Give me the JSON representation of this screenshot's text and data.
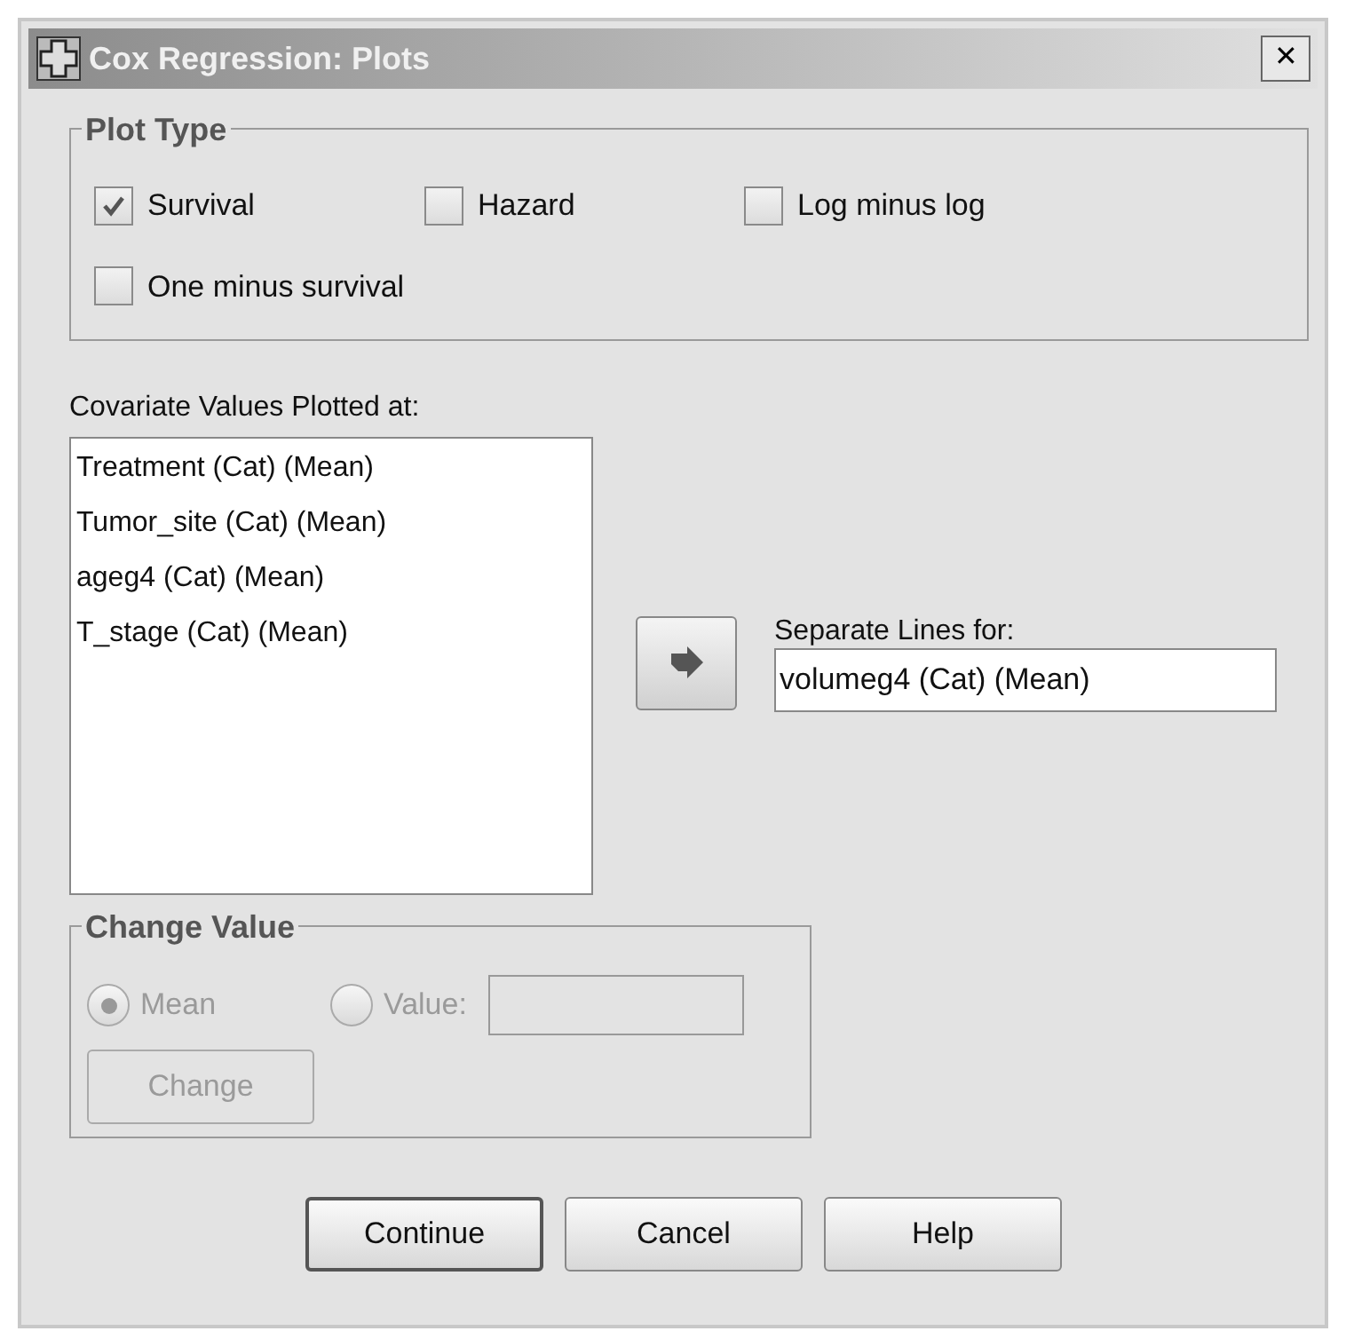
{
  "window": {
    "title": "Cox Regression: Plots",
    "close": "✕"
  },
  "plot_type": {
    "legend": "Plot Type",
    "options": [
      {
        "label": "Survival",
        "checked": true
      },
      {
        "label": "Hazard",
        "checked": false
      },
      {
        "label": "Log minus log",
        "checked": false
      },
      {
        "label": "One minus survival",
        "checked": false
      }
    ]
  },
  "covariates": {
    "label": "Covariate Values Plotted at:",
    "items": [
      "Treatment (Cat) (Mean)",
      "Tumor_site (Cat) (Mean)",
      "ageg4 (Cat) (Mean)",
      "T_stage (Cat) (Mean)"
    ]
  },
  "separate_lines": {
    "label": "Separate Lines for:",
    "value": "volumeg4 (Cat) (Mean)"
  },
  "change_value": {
    "legend": "Change Value",
    "disabled": true,
    "options": [
      {
        "label": "Mean",
        "selected": true
      },
      {
        "label": "Value:",
        "selected": false
      }
    ],
    "button": "Change"
  },
  "buttons": [
    {
      "label": "Continue",
      "default": true
    },
    {
      "label": "Cancel",
      "default": false
    },
    {
      "label": "Help",
      "default": false
    }
  ]
}
